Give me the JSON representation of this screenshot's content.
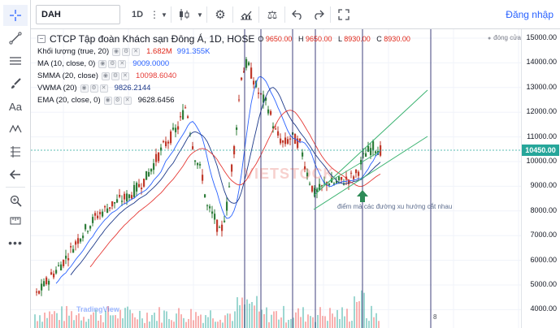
{
  "toolbar": {
    "symbol": "DAH",
    "interval": "1D",
    "login_label": "Đăng nhập"
  },
  "legend": {
    "title": "CTCP Tập đoàn Khách sạn Đông Á, 1D, HOSE",
    "ohlc": {
      "o_label": "O",
      "o": "9650.00",
      "h_label": "H",
      "h": "9650.00",
      "l_label": "L",
      "l": "8930.00",
      "c_label": "C",
      "c": "8930.00"
    },
    "volume": {
      "label": "Khối lượng (true, 20)",
      "v1": "1.682M",
      "v2": "991.355K"
    },
    "ma": {
      "label": "MA (10, close, 0)",
      "value": "9009.0000"
    },
    "smma": {
      "label": "SMMA (20, close)",
      "value": "10098.6040"
    },
    "vwma": {
      "label": "VWMA (20)",
      "value": "9826.2144"
    },
    "ema": {
      "label": "EMA (20, close, 0)",
      "value": "9628.6456"
    }
  },
  "dong_cua": "đóng cửa",
  "annotation": "điểm mà các đường xu hướng cắt nhau",
  "watermark": "VIETSTOCK",
  "tv_logo": "TradingView",
  "last_price": "10450.00",
  "price_ticks": [
    "15000.00",
    "14000.00",
    "13000.00",
    "12000.00",
    "11000.00",
    "10000.00",
    "9000.00",
    "8000.00",
    "7000.00",
    "6000.00",
    "5000.00",
    "4000.00"
  ],
  "bottom_label": "8",
  "colors": {
    "up": "#26a69a",
    "down": "#ef5350",
    "candle_up": "#2f7d3a",
    "candle_down": "#c0392b",
    "ma": "#2962ff",
    "smma": "#e53935",
    "vwma": "#1e3a8a",
    "ema": "#6b7280",
    "channel": "#3cb371",
    "arrow": "#2e8b57",
    "vline": "#2b2d6e",
    "last_price": "#26a69a"
  },
  "icons": {
    "crosshair": "crosshair-icon",
    "trendline": "trendline-icon",
    "lines": "horizontal-lines-icon",
    "brush": "brush-icon",
    "text": "text-icon",
    "pattern": "pattern-icon",
    "fib": "fibonacci-icon",
    "back": "arrow-left-icon",
    "zoom": "zoom-icon",
    "measure": "measure-icon",
    "more": "more-icon"
  }
}
